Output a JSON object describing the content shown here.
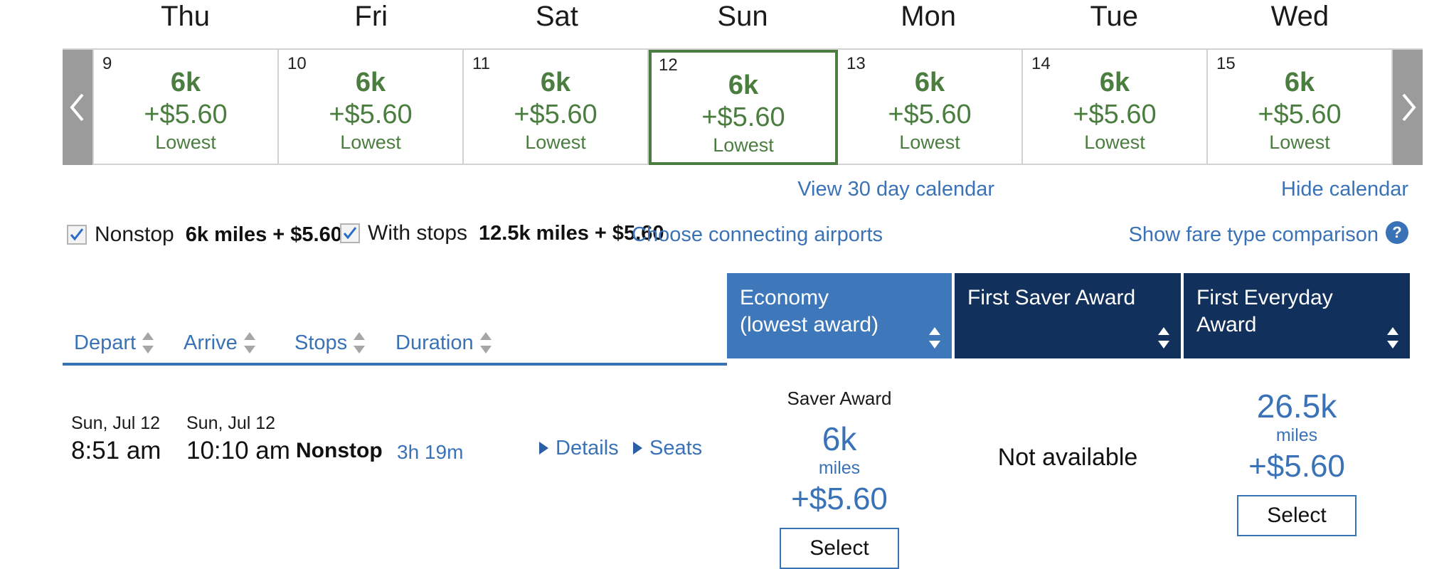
{
  "calendar": {
    "prev_label": "Previous dates",
    "next_label": "Next dates",
    "days": [
      {
        "dayname": "Thu",
        "daynum": "9",
        "miles": "6k",
        "price": "+$5.60",
        "tag": "Lowest",
        "selected": false
      },
      {
        "dayname": "Fri",
        "daynum": "10",
        "miles": "6k",
        "price": "+$5.60",
        "tag": "Lowest",
        "selected": false
      },
      {
        "dayname": "Sat",
        "daynum": "11",
        "miles": "6k",
        "price": "+$5.60",
        "tag": "Lowest",
        "selected": false
      },
      {
        "dayname": "Sun",
        "daynum": "12",
        "miles": "6k",
        "price": "+$5.60",
        "tag": "Lowest",
        "selected": true
      },
      {
        "dayname": "Mon",
        "daynum": "13",
        "miles": "6k",
        "price": "+$5.60",
        "tag": "Lowest",
        "selected": false
      },
      {
        "dayname": "Tue",
        "daynum": "14",
        "miles": "6k",
        "price": "+$5.60",
        "tag": "Lowest",
        "selected": false
      },
      {
        "dayname": "Wed",
        "daynum": "15",
        "miles": "6k",
        "price": "+$5.60",
        "tag": "Lowest",
        "selected": false
      }
    ],
    "view_30_day_label": "View 30 day calendar",
    "hide_calendar_label": "Hide calendar"
  },
  "filters": {
    "nonstop": {
      "label": "Nonstop",
      "value": "6k miles + $5.60",
      "checked": true
    },
    "with_stops": {
      "label": "With stops",
      "value": "12.5k miles + $5.60",
      "checked": true
    },
    "choose_connecting_label": "Choose connecting airports",
    "fare_comparison_label": "Show fare type comparison",
    "help_glyph": "?"
  },
  "table": {
    "sort_columns": [
      {
        "label": "Depart"
      },
      {
        "label": "Arrive"
      },
      {
        "label": "Stops"
      },
      {
        "label": "Duration"
      }
    ],
    "fare_headers": [
      {
        "title": "Economy",
        "subtitle": "(lowest award)",
        "accent": "#3e78bb"
      },
      {
        "title": "First Saver Award",
        "subtitle": "",
        "accent": "#12305c"
      },
      {
        "title": "First Everyday Award",
        "subtitle": "",
        "accent": "#12305c"
      }
    ],
    "rows": [
      {
        "depart_date": "Sun, Jul 12",
        "depart_time": "8:51 am",
        "arrive_date": "Sun, Jul 12",
        "arrive_time": "10:10 am",
        "stops": "Nonstop",
        "duration": "3h 19m",
        "details_label": "Details",
        "seats_label": "Seats",
        "fares": [
          {
            "kicker": "Saver Award",
            "miles": "6k",
            "miles_word": "miles",
            "price": "+$5.60",
            "button": "Select",
            "available": true
          },
          {
            "kicker": "",
            "miles": "",
            "miles_word": "",
            "price": "",
            "button": "",
            "available": false,
            "unavailable_text": "Not available"
          },
          {
            "kicker": "",
            "miles": "26.5k",
            "miles_word": "miles",
            "price": "+$5.60",
            "button": "Select",
            "available": true
          }
        ]
      }
    ]
  },
  "colors": {
    "link_blue": "#3a72b8",
    "header_blue": "#3e78bb",
    "header_navy": "#12305c",
    "calendar_green": "#4a7d3f",
    "arrow_gray": "#9b9b9b"
  }
}
